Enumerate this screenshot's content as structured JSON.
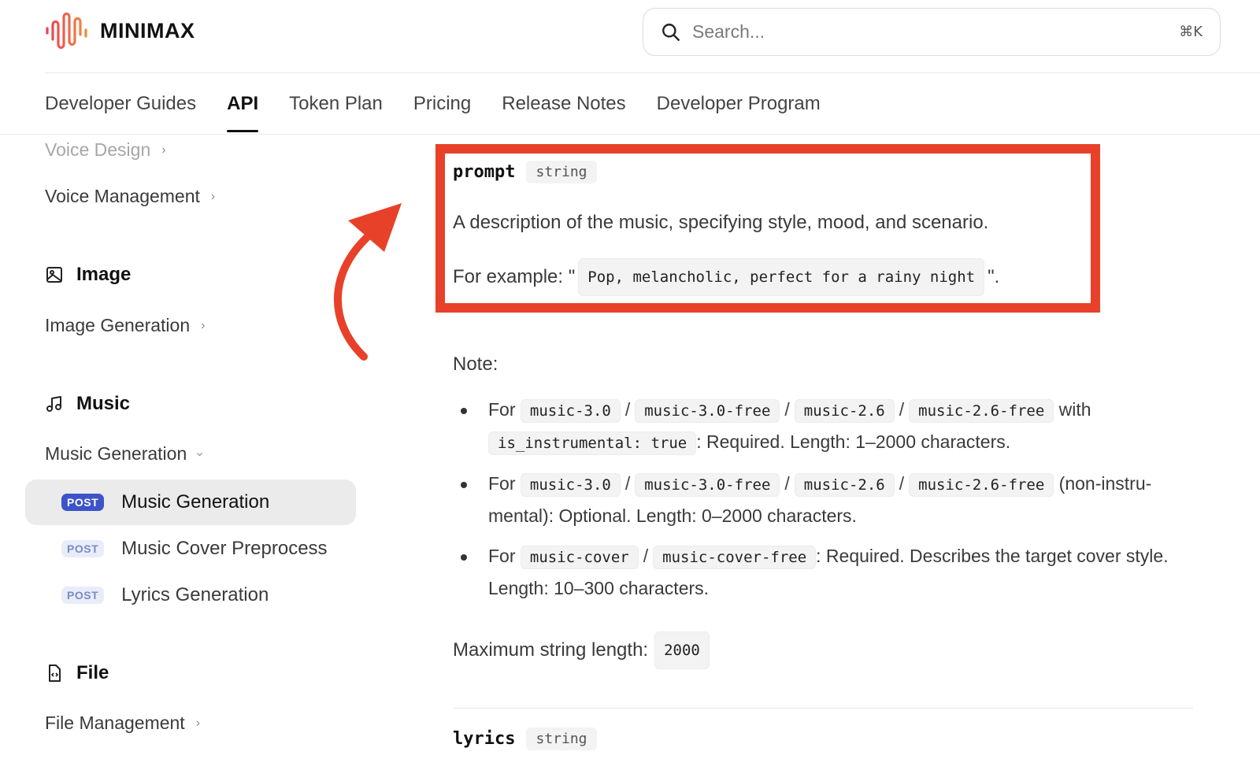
{
  "header": {
    "logo_text": "MINIMAX",
    "search_placeholder": "Search...",
    "search_shortcut": "⌘K"
  },
  "tabs": [
    {
      "label": "Developer Guides",
      "active": false
    },
    {
      "label": "API",
      "active": true
    },
    {
      "label": "Token Plan",
      "active": false
    },
    {
      "label": "Pricing",
      "active": false
    },
    {
      "label": "Release Notes",
      "active": false
    },
    {
      "label": "Developer Program",
      "active": false
    }
  ],
  "sidebar": {
    "voice_design": "Voice Design",
    "voice_management": "Voice Management",
    "image_section": "Image",
    "image_generation": "Image Generation",
    "music_section": "Music",
    "music_generation_group": "Music Generation",
    "sub_items": [
      {
        "method": "POST",
        "label": "Music Generation",
        "active": true
      },
      {
        "method": "POST",
        "label": "Music Cover Preprocess",
        "active": false
      },
      {
        "method": "POST",
        "label": "Lyrics Generation",
        "active": false
      }
    ],
    "file_section": "File",
    "file_management": "File Management"
  },
  "content": {
    "prompt_field": {
      "name": "prompt",
      "type": "string",
      "description": "A description of the music, specifying style, mood, and scenario.",
      "example_prefix": "For example: \"",
      "example_code": "Pop, melancholic, perfect for a rainy night",
      "example_suffix": "\"."
    },
    "note_label": "Note:",
    "notes": [
      {
        "prefix": "For",
        "models": [
          "music-3.0",
          "music-3.0-free",
          "music-2.6",
          "music-2.6-free"
        ],
        "mid": "with",
        "code_extra": "is_instrumental: true",
        "text": ": Required. Length: 1–2000 characters."
      },
      {
        "prefix": "For",
        "models": [
          "music-3.0",
          "music-3.0-free",
          "music-2.6",
          "music-2.6-free"
        ],
        "text": "(non-instru-mental): Optional. Length: 0–2000 characters."
      },
      {
        "prefix": "For",
        "models": [
          "music-cover",
          "music-cover-free"
        ],
        "text": ": Required. Describes the target cover style. Length: 10–300 characters."
      }
    ],
    "max_length_label": "Maximum string length:",
    "max_length_value": "2000",
    "lyrics_field": {
      "name": "lyrics",
      "type": "string"
    }
  },
  "colors": {
    "highlight": "#e8412a",
    "badge_active": "#3d53c9",
    "badge_inactive_bg": "#e9edf9",
    "logo_gradient_start": "#e8415a",
    "logo_gradient_end": "#f08a3c"
  }
}
